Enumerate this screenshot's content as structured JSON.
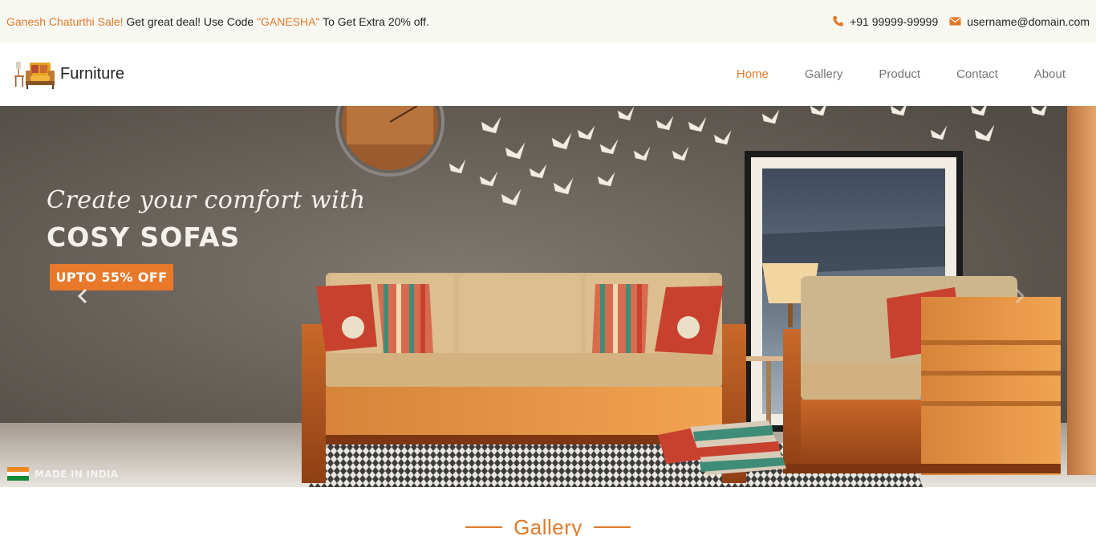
{
  "topbar": {
    "promo_sale": "Ganesh Chaturthi Sale!",
    "promo_text_1": " Get great deal! Use Code ",
    "promo_code": "\"GANESHA\"",
    "promo_text_2": " To Get Extra 20% off.",
    "phone_icon": "phone-icon",
    "phone": "+91 99999-99999",
    "email_icon": "envelope-icon",
    "email": "username@domain.com"
  },
  "brand": {
    "logo_icon": "armchair-logo",
    "name": "Furniture"
  },
  "nav": {
    "items": [
      {
        "label": "Home",
        "active": true
      },
      {
        "label": "Gallery",
        "active": false
      },
      {
        "label": "Product",
        "active": false
      },
      {
        "label": "Contact",
        "active": false
      },
      {
        "label": "About",
        "active": false
      }
    ]
  },
  "hero": {
    "script_line": "Create your comfort with",
    "headline": "COSY SOFAS",
    "offer": "UPTO 55% OFF",
    "made_in": "MADE IN INDIA",
    "prev_icon": "chevron-left-icon",
    "next_icon": "chevron-right-icon"
  },
  "gallery": {
    "title": "Gallery"
  },
  "colors": {
    "accent": "#e07a2a",
    "topbar_bg": "#f8f8f3",
    "nav_text": "#777777",
    "wall": "#6e6862",
    "offer_bg": "#e8792a"
  }
}
